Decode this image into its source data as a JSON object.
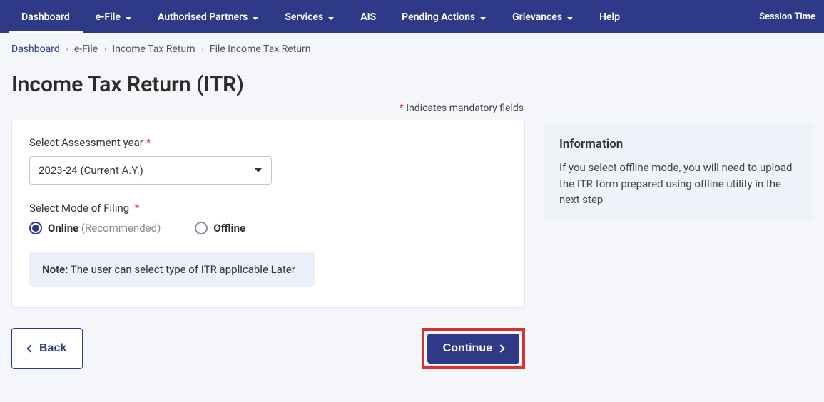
{
  "nav": {
    "items": [
      "Dashboard",
      "e-File",
      "Authorised Partners",
      "Services",
      "AIS",
      "Pending Actions",
      "Grievances",
      "Help"
    ],
    "has_dropdown": [
      false,
      true,
      true,
      true,
      false,
      true,
      true,
      false
    ],
    "active_index": 0,
    "session_label": "Session Time"
  },
  "breadcrumb": {
    "items": [
      "Dashboard",
      "e-File",
      "Income Tax Return",
      "File Income Tax Return"
    ]
  },
  "page": {
    "title": "Income Tax Return (ITR)",
    "mandatory_prefix": "*",
    "mandatory_text": " Indicates mandatory fields"
  },
  "form": {
    "assessment_label": "Select Assessment year",
    "assessment_value": "2023-24 (Current A.Y.)",
    "mode_label": "Select Mode of Filing",
    "options": {
      "online_label": "Online",
      "online_sub": " (Recommended)",
      "offline_label": "Offline",
      "selected": "online"
    },
    "note_label": "Note:",
    "note_text": " The user can select type of ITR applicable Later"
  },
  "buttons": {
    "back": "Back",
    "continue": "Continue"
  },
  "info": {
    "title": "Information",
    "text": "If you select offline mode, you will need to upload the ITR form prepared using offline utility in the next step"
  }
}
